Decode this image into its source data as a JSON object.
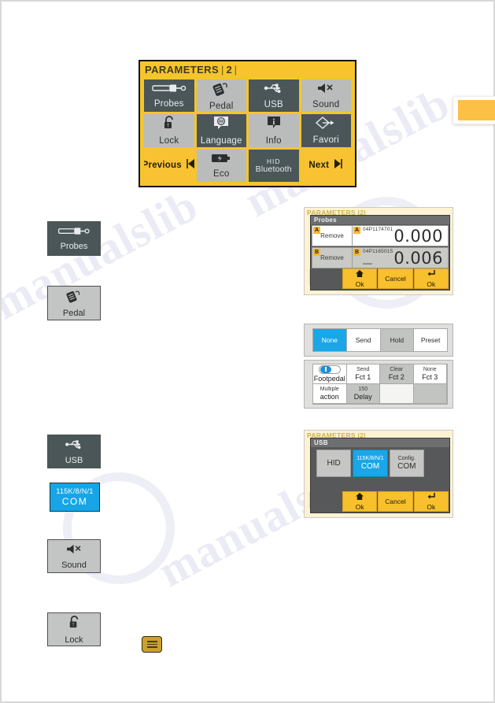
{
  "document": {
    "watermark": "manualslib"
  },
  "side_tab": {
    "name": "page-marker-tab",
    "color": "#fcc047"
  },
  "parameters_screen": {
    "title": "PARAMETERS",
    "separator": "|",
    "page_number": "2",
    "buttons": [
      {
        "label": "Probes",
        "icon": "probe-icon",
        "style": "dark"
      },
      {
        "label": "Pedal",
        "icon": "pedal-icon",
        "style": "light"
      },
      {
        "label": "USB",
        "icon": "usb-icon",
        "style": "dark"
      },
      {
        "label": "Sound",
        "icon": "sound-off-icon",
        "style": "light"
      },
      {
        "label": "Lock",
        "icon": "lock-open-icon",
        "style": "light"
      },
      {
        "label": "Language",
        "icon": "language-icon",
        "style": "dark"
      },
      {
        "label": "Info",
        "icon": "info-icon",
        "style": "light"
      },
      {
        "label": "Favori",
        "icon": "favorite-icon",
        "style": "dark"
      },
      {
        "label": "Previous",
        "icon": "arrow-left-icon",
        "style": "amber"
      },
      {
        "label": "Eco",
        "icon": "battery-eco-icon",
        "style": "light"
      },
      {
        "label": "HID",
        "sublabel": "Bluetooth",
        "icon": "bluetooth-icon",
        "style": "dark"
      },
      {
        "label": "Next",
        "icon": "arrow-right-icon",
        "style": "amber"
      }
    ]
  },
  "legend_chips": [
    {
      "key": "probes",
      "label": "Probes",
      "style": "dark",
      "icon": "probe-icon"
    },
    {
      "key": "pedal",
      "label": "Pedal",
      "style": "light",
      "icon": "pedal-icon"
    },
    {
      "key": "usb",
      "label": "USB",
      "style": "dark",
      "icon": "usb-icon"
    },
    {
      "key": "usb_com",
      "line1": "115K/8/N/1",
      "line2": "COM",
      "style": "blue"
    },
    {
      "key": "sound",
      "label": "Sound",
      "style": "light",
      "icon": "sound-off-icon"
    },
    {
      "key": "lock",
      "label": "Lock",
      "style": "light",
      "icon": "lock-open-icon"
    }
  ],
  "probes_dialog": {
    "background_title": "PARAMETERS |2|",
    "title": "Probes",
    "rows": [
      {
        "tag": "A",
        "remove_label": "Remove",
        "serial": "04P1174701",
        "sign": "",
        "value": "0.000"
      },
      {
        "tag": "B",
        "remove_label": "Remove",
        "serial": "04P1165015",
        "sign": "—",
        "value": "0.006"
      }
    ],
    "actions": [
      {
        "glyph": "home-icon",
        "label": "Ok"
      },
      {
        "glyph": "",
        "label": "Cancel"
      },
      {
        "glyph": "enter-arrow-icon",
        "label": "Ok"
      }
    ]
  },
  "pedal_mode_panel": {
    "options": [
      {
        "label": "None",
        "state": "selected"
      },
      {
        "label": "Send",
        "state": "normal"
      },
      {
        "label": "Hold",
        "state": "gray"
      },
      {
        "label": "Preset",
        "state": "normal"
      }
    ]
  },
  "pedal_config_panel": {
    "cells": [
      {
        "top": "",
        "bottom": "Footpedal",
        "kind": "toggle",
        "toggle": "on",
        "style": "normal"
      },
      {
        "top": "Send",
        "bottom": "Fct 1",
        "kind": "text",
        "style": "normal"
      },
      {
        "top": "Clear",
        "bottom": "Fct 2",
        "kind": "text",
        "style": "gray"
      },
      {
        "top": "None",
        "bottom": "Fct 3",
        "kind": "text",
        "style": "normal"
      },
      {
        "top": "Multiple",
        "bottom": "action",
        "kind": "text",
        "style": "normal"
      },
      {
        "top": "150",
        "bottom": "Delay",
        "kind": "text",
        "style": "gray"
      },
      {
        "top": "",
        "bottom": "",
        "kind": "blank",
        "style": "blank"
      },
      {
        "top": "",
        "bottom": "",
        "kind": "blank",
        "style": "gray"
      }
    ]
  },
  "usb_dialog": {
    "background_title": "PARAMETERS |2|",
    "title": "USB",
    "options": [
      {
        "line1": "",
        "line2": "HID",
        "state": "normal"
      },
      {
        "line1": "115K/8/N/1",
        "line2": "COM",
        "state": "selected"
      },
      {
        "line1": "Config.",
        "line2": "COM",
        "state": "normal"
      }
    ],
    "actions": [
      {
        "glyph": "home-icon",
        "label": "Ok"
      },
      {
        "glyph": "",
        "label": "Cancel"
      },
      {
        "glyph": "enter-arrow-icon",
        "label": "Ok"
      }
    ]
  },
  "list_icon": {
    "name": "menu-list-icon"
  }
}
